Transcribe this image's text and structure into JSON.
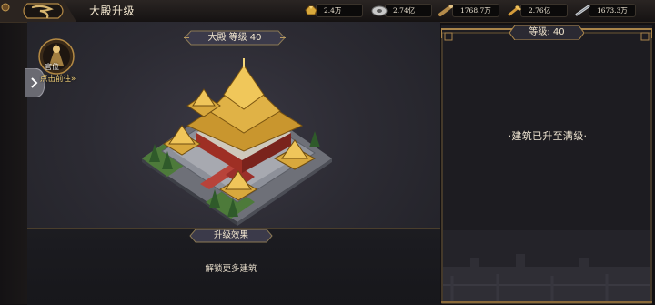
{
  "header": {
    "title": "大殿升级"
  },
  "resources": [
    {
      "icon": "gold-ingot-icon",
      "value": "2.4万"
    },
    {
      "icon": "silver-coin-icon",
      "value": "2.74亿"
    },
    {
      "icon": "timber-log-icon",
      "value": "1768.7万"
    },
    {
      "icon": "grain-sack-icon",
      "value": "2.76亿"
    },
    {
      "icon": "iron-bar-icon",
      "value": "1673.3万"
    }
  ],
  "side_widget": {
    "rank_label": "官位",
    "goto_label": "点击前往»"
  },
  "building": {
    "banner": "大殿 等级 40",
    "effect_title": "升级效果",
    "effect_desc": "解锁更多建筑"
  },
  "info_panel": {
    "level_tag": "等级: 40",
    "status": "·建筑已升至满级·"
  },
  "colors": {
    "gold": "#c9a25a",
    "panel_bg": "#2c2b33",
    "frame": "#8a6a3a"
  }
}
